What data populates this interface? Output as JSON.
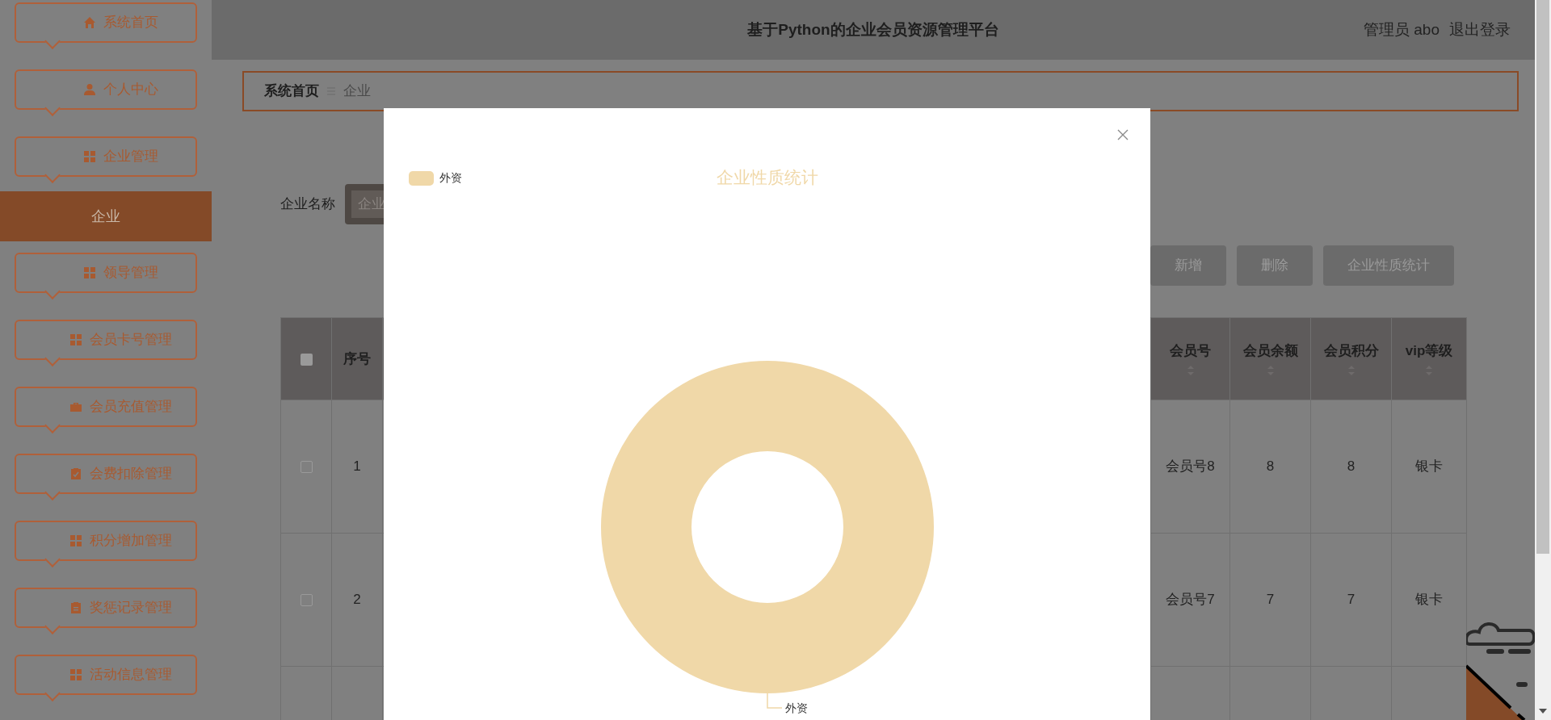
{
  "sidebar": {
    "items": [
      {
        "label": "系统首页",
        "kind": "home",
        "selected": false
      },
      {
        "label": "个人中心",
        "kind": "person",
        "selected": false
      },
      {
        "label": "企业管理",
        "kind": "grid",
        "selected": false
      },
      {
        "label": "企业",
        "kind": "sub",
        "selected": true
      },
      {
        "label": "领导管理",
        "kind": "grid",
        "selected": false
      },
      {
        "label": "会员卡号管理",
        "kind": "grid",
        "selected": false
      },
      {
        "label": "会员充值管理",
        "kind": "case",
        "selected": false
      },
      {
        "label": "会费扣除管理",
        "kind": "check",
        "selected": false
      },
      {
        "label": "积分增加管理",
        "kind": "grid",
        "selected": false
      },
      {
        "label": "奖惩记录管理",
        "kind": "clip",
        "selected": false
      },
      {
        "label": "活动信息管理",
        "kind": "grid",
        "selected": false
      }
    ]
  },
  "header": {
    "title": "基于Python的企业会员资源管理平台",
    "user": "管理员 abo",
    "logout": "退出登录"
  },
  "breadcrumb": {
    "home": "系统首页",
    "current": "企业"
  },
  "search": {
    "label": "企业名称",
    "placeholder": "企业"
  },
  "buttons": [
    "新增",
    "删除",
    "企业性质统计"
  ],
  "table": {
    "header_checked": false,
    "columns": [
      {
        "label": "序号",
        "sortable": false
      },
      {
        "label": "会员号",
        "sortable": true
      },
      {
        "label": "会员余额",
        "sortable": true
      },
      {
        "label": "会员积分",
        "sortable": true
      },
      {
        "label": "vip等级",
        "sortable": true
      }
    ],
    "rows": [
      {
        "checked": false,
        "cells": [
          "1",
          "会员号8",
          "8",
          "8",
          "银卡"
        ]
      },
      {
        "checked": false,
        "cells": [
          "2",
          "会员号7",
          "7",
          "7",
          "银卡"
        ]
      },
      {
        "cells": []
      }
    ]
  },
  "modal": {
    "legend": [
      {
        "label": "外资",
        "color": "#f0d8a8"
      }
    ],
    "chart_data": {
      "type": "donut",
      "title": "企业性质统计",
      "categories": [
        "外资"
      ]
    }
  }
}
